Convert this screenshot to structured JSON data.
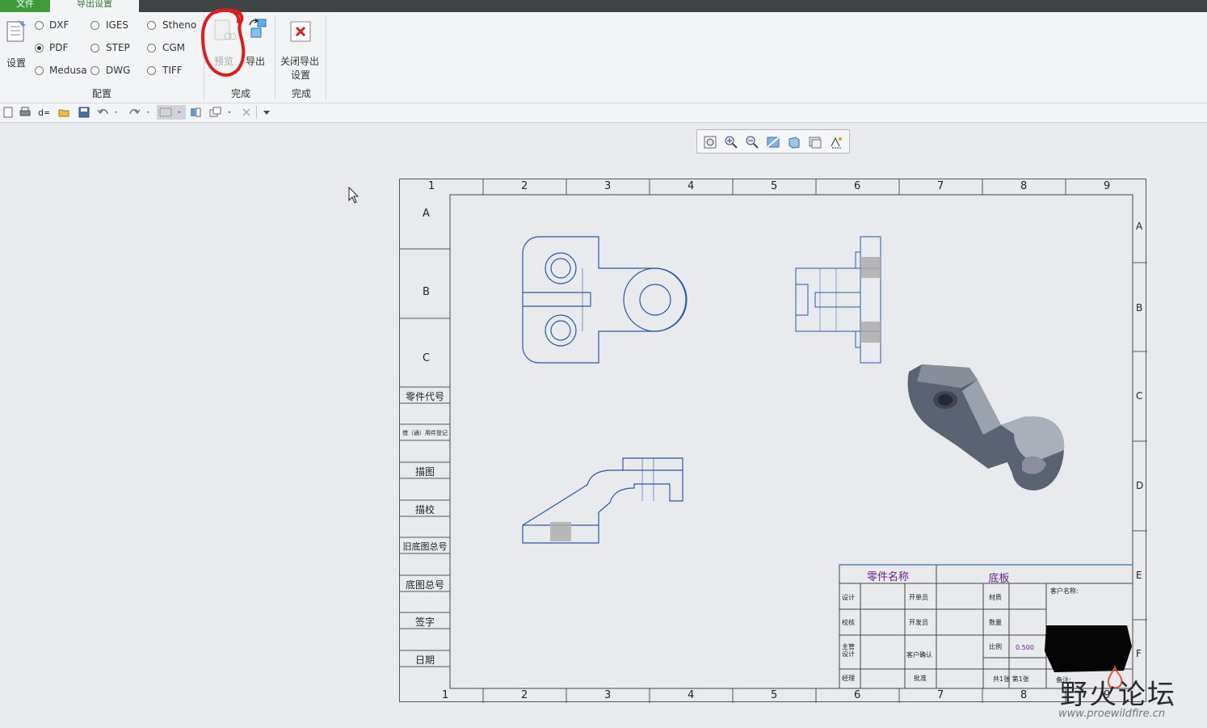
{
  "tabs": {
    "file": "文件",
    "export_settings": "导出设置"
  },
  "ribbon": {
    "settings_label": "设置",
    "formats": [
      {
        "label": "DXF",
        "selected": false
      },
      {
        "label": "IGES",
        "selected": false
      },
      {
        "label": "Stheno",
        "selected": false
      },
      {
        "label": "PDF",
        "selected": true
      },
      {
        "label": "STEP",
        "selected": false
      },
      {
        "label": "CGM",
        "selected": false
      },
      {
        "label": "Medusa",
        "selected": false
      },
      {
        "label": "DWG",
        "selected": false
      },
      {
        "label": "TIFF",
        "selected": false
      }
    ],
    "group_config": "配置",
    "preview_label": "预览",
    "export_label": "导出",
    "group_finish": "完成",
    "close_label_1": "关闭导出",
    "close_label_2": "设置",
    "group_finish2": "完成"
  },
  "sheet": {
    "columns": [
      "1",
      "2",
      "3",
      "4",
      "5",
      "6",
      "7",
      "8",
      "9"
    ],
    "rows_left": [
      "A",
      "B",
      "C"
    ],
    "rows_right": [
      "A",
      "B",
      "C",
      "D",
      "E",
      "F"
    ],
    "left_table": [
      "零件代号",
      "借（通）用件登记",
      "描图",
      "描校",
      "旧底图总号",
      "底图总号",
      "签字",
      "日期"
    ],
    "title_block": {
      "part_name_label": "零件名称",
      "part_name_value": "底板",
      "design": "设计",
      "check": "校核",
      "chief_design": "主管设计",
      "approve_manager": "经理",
      "develop": "开单员",
      "dev_review": "开发员",
      "customer_confirm": "客户确认",
      "approve": "批准",
      "material": "材质",
      "quantity": "数量",
      "scale_label": "比例",
      "scale_value": "0.500",
      "sheets": "共1张 第1张",
      "customer_name": "客户名称:",
      "remarks": "备注:"
    }
  },
  "watermark": {
    "name": "野火论坛",
    "url": "www.proewildfire.cn"
  }
}
